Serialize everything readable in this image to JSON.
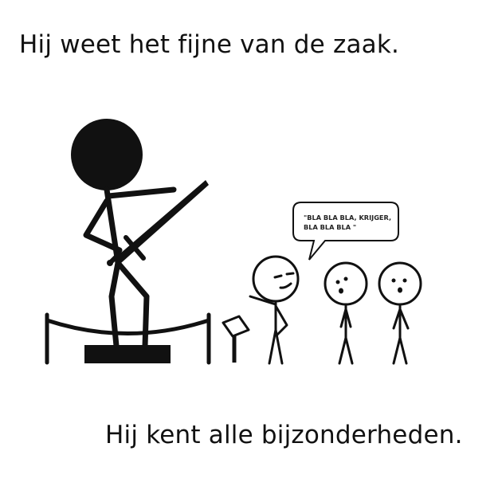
{
  "captions": {
    "top": "Hij weet het fijne van de zaak.",
    "bottom": "Hij kent alle bijzonderheden."
  },
  "speech_bubble": {
    "line1": "\"BLA BLA BLA, KRIJGER,",
    "line2": "BLA BLA BLA \""
  },
  "colors": {
    "ink": "#111111",
    "background": "#ffffff"
  }
}
